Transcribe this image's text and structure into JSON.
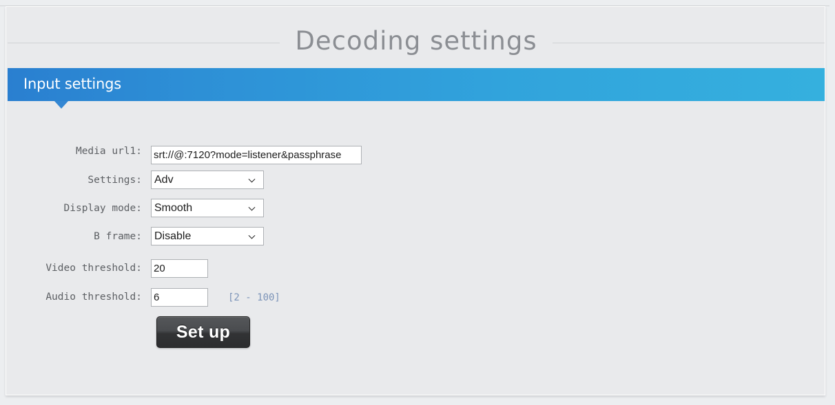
{
  "page": {
    "title": "Decoding  settings"
  },
  "tab": {
    "label": "Input settings"
  },
  "form": {
    "fields": [
      {
        "label": "Media url1:",
        "type": "text",
        "value": "srt://@:7120?mode=listener&passphrase",
        "placeholder": ""
      },
      {
        "label": "Settings:",
        "type": "select",
        "value": "Adv",
        "options": [
          "Adv"
        ]
      },
      {
        "label": "Display mode:",
        "type": "select",
        "value": "Smooth",
        "options": [
          "Smooth"
        ]
      },
      {
        "label": "B frame:",
        "type": "select",
        "value": "Disable",
        "options": [
          "Disable"
        ]
      },
      {
        "label": "Video threshold:",
        "type": "text",
        "value": "20",
        "placeholder": ""
      },
      {
        "label": "Audio threshold:",
        "type": "text",
        "value": "6",
        "placeholder": "",
        "hint": "[2 - 100]"
      }
    ],
    "submit_label": "Set up"
  },
  "colors": {
    "tab_start": "#2a7fd0",
    "tab_end": "#35b0de",
    "page_bg": "#eceef0",
    "title_text": "#8b8e93",
    "hint_text": "#7b93b8"
  }
}
